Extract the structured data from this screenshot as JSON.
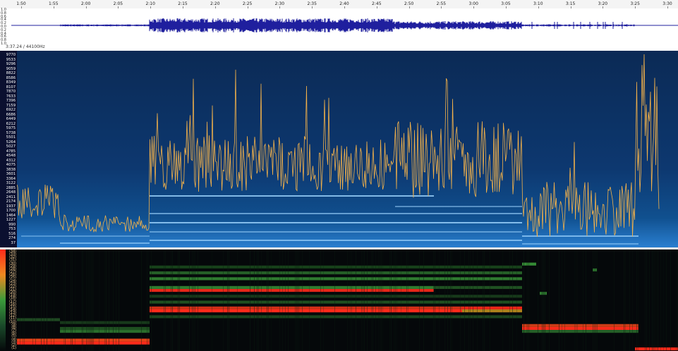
{
  "app": {
    "duration_readout": "3:37.24 / 44100Hz"
  },
  "timeline": {
    "ticks": [
      {
        "label": "1:50",
        "t": 110
      },
      {
        "label": "1:55",
        "t": 115
      },
      {
        "label": "2:00",
        "t": 120
      },
      {
        "label": "2:05",
        "t": 125
      },
      {
        "label": "2:10",
        "t": 130
      },
      {
        "label": "2:15",
        "t": 135
      },
      {
        "label": "2:20",
        "t": 140
      },
      {
        "label": "2:25",
        "t": 145
      },
      {
        "label": "2:30",
        "t": 150
      },
      {
        "label": "2:35",
        "t": 155
      },
      {
        "label": "2:40",
        "t": 160
      },
      {
        "label": "2:45",
        "t": 165
      },
      {
        "label": "2:50",
        "t": 170
      },
      {
        "label": "2:55",
        "t": 175
      },
      {
        "label": "3:00",
        "t": 180
      },
      {
        "label": "3:05",
        "t": 185
      },
      {
        "label": "3:10",
        "t": 190
      },
      {
        "label": "3:15",
        "t": 195
      },
      {
        "label": "3:20",
        "t": 200
      },
      {
        "label": "3:25",
        "t": 205
      },
      {
        "label": "3:30",
        "t": 210
      }
    ]
  },
  "waveform": {
    "amplitude_labels": [
      "1.0",
      "0.8",
      "0.6",
      "0.4",
      "0.2",
      "0.0",
      "0.2",
      "0.4",
      "0.6",
      "0.8",
      "1.0"
    ],
    "color": "#1f1f9e"
  },
  "spectrogram": {
    "frequency_labels": [
      "9770",
      "9533",
      "9296",
      "9059",
      "8822",
      "8586",
      "8349",
      "8107",
      "7870",
      "7633",
      "7396",
      "7159",
      "6922",
      "6686",
      "6449",
      "6212",
      "5975",
      "5738",
      "5501",
      "5264",
      "5027",
      "4785",
      "4548",
      "4312",
      "4075",
      "3838",
      "3601",
      "3364",
      "3122",
      "2885",
      "2648",
      "2411",
      "2174",
      "1937",
      "1700",
      "1464",
      "1227",
      "990",
      "753",
      "516",
      "274",
      "37"
    ],
    "background": "#0b2e5c",
    "pitch_curve_color": "#f4b24a"
  },
  "chromagram": {
    "labels": [
      "(34)",
      "(33)",
      "(32)",
      "(31)",
      "(30)",
      "(29)",
      "(28)",
      "(27)",
      "(26)",
      "(25)",
      "(24)",
      "(23)",
      "(22)",
      "(21)",
      "(20)",
      "(19)",
      "(18)",
      "(17)",
      "(16)",
      "(15)",
      "(14)",
      "(13)",
      "(12)",
      "(11)",
      "(10)",
      "(9)",
      "(8)",
      "(7)",
      "(6)",
      "(5)",
      "(4)",
      "(3)",
      "(2)",
      "(1)"
    ],
    "active_color": "#ff2a1a",
    "mid_color": "#3a9a3a"
  }
}
